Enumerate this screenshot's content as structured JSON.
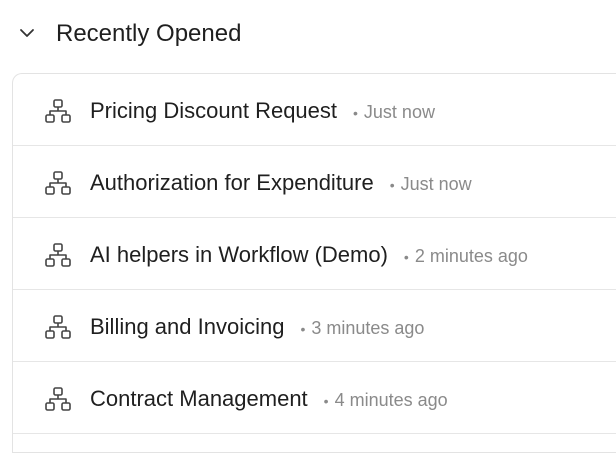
{
  "section": {
    "title": "Recently Opened",
    "toggle_icon": "chevron-down-icon"
  },
  "items": [
    {
      "name": "Pricing Discount Request",
      "separator": "•",
      "time": "Just now",
      "icon": "workflow-icon"
    },
    {
      "name": "Authorization for Expenditure",
      "separator": "•",
      "time": "Just now",
      "icon": "workflow-icon"
    },
    {
      "name": "AI helpers in Workflow (Demo)",
      "separator": "•",
      "time": "2 minutes ago",
      "icon": "workflow-icon"
    },
    {
      "name": "Billing and Invoicing",
      "separator": "•",
      "time": "3 minutes ago",
      "icon": "workflow-icon"
    },
    {
      "name": "Contract Management",
      "separator": "•",
      "time": "4 minutes ago",
      "icon": "workflow-icon"
    }
  ],
  "colors": {
    "text": "#1f1f1f",
    "muted": "#8a8a8a",
    "border": "#e3e3e3",
    "icon": "#444444"
  }
}
